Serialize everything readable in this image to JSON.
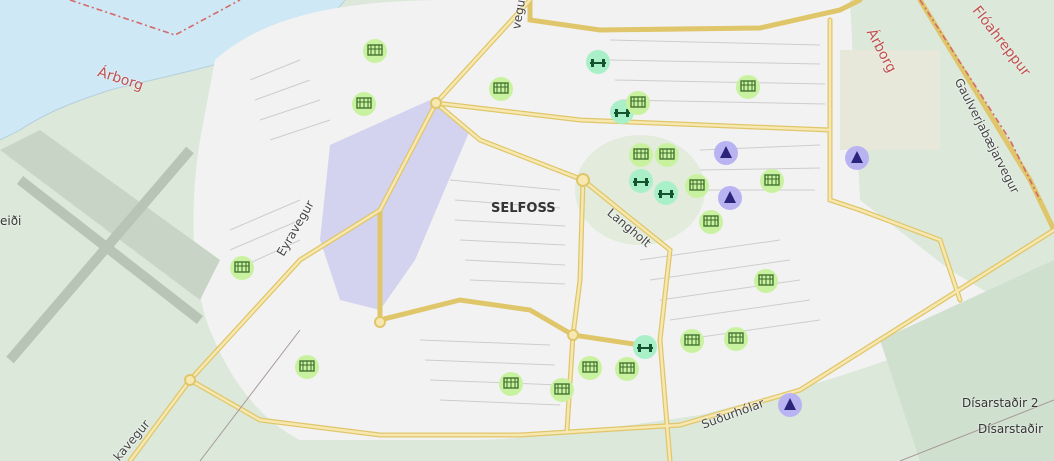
{
  "map": {
    "town_label": "SELFOSS",
    "admin_labels": [
      {
        "id": "arborg-west",
        "text": "Árborg"
      },
      {
        "id": "arborg-east",
        "text": "Árborg"
      },
      {
        "id": "floahreppur",
        "text": "Flóahreppur"
      }
    ],
    "road_labels": [
      {
        "id": "eyravegur",
        "text": "Eyravegur"
      },
      {
        "id": "langholt",
        "text": "Langholt"
      },
      {
        "id": "sudurholar",
        "text": "Suðurhólar"
      },
      {
        "id": "gaulverjabaejarvegur",
        "text": "Gaulverjabæjarvegur"
      },
      {
        "id": "kavegur",
        "text": "kavegur"
      },
      {
        "id": "top-road",
        "text": "vegur"
      }
    ],
    "farm_labels": [
      {
        "id": "disarstadir-2",
        "text": "Dísarstaðir 2"
      },
      {
        "id": "disarstadir",
        "text": "Dísarstaðir"
      },
      {
        "id": "eidi",
        "text": "eiði"
      }
    ],
    "poi_types": {
      "park": {
        "icon": "playground-icon",
        "color": "#c9f2a0"
      },
      "sport": {
        "icon": "fitness-icon",
        "color": "#a9f0c8"
      },
      "culture": {
        "icon": "culture-icon",
        "color": "#b9b3f2"
      }
    },
    "colors": {
      "water": "#cfe8f5",
      "green": "#d5e6d3",
      "urban": "#f3f3f3",
      "industrial": "#d3d3ef",
      "major_road": "#f2dd8f",
      "admin_border": "#d46a6a"
    }
  }
}
